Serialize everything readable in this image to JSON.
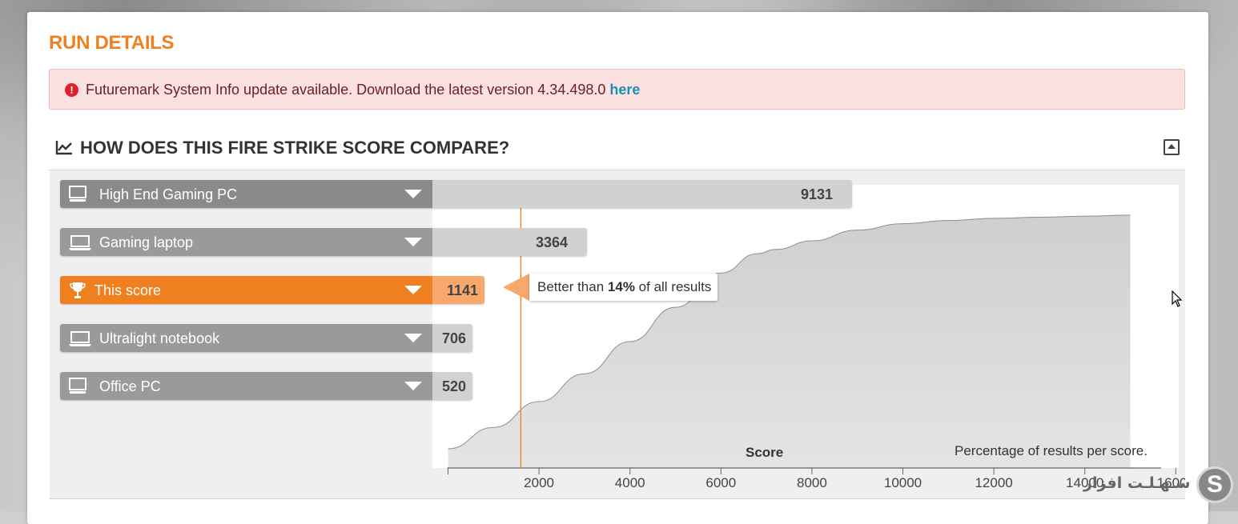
{
  "run_details": {
    "title": "RUN DETAILS"
  },
  "alert": {
    "icon": "error-exclamation-icon",
    "message": "Futuremark System Info update available. Download the latest version 4.34.498.0",
    "link_text": "here",
    "color": "#e0202a"
  },
  "compare": {
    "icon": "line-chart-icon",
    "title": "HOW DOES THIS FIRE STRIKE SCORE COMPARE?",
    "collapse_icon": "collapse-up-icon",
    "max_score": 16000,
    "rows": [
      {
        "label": "High End Gaming PC",
        "score": 9131,
        "icon": "desktop-monitor-icon",
        "highlight": false
      },
      {
        "label": "Gaming laptop",
        "score": 3364,
        "icon": "laptop-icon",
        "highlight": false
      },
      {
        "label": "This score",
        "score": 1141,
        "icon": "trophy-icon",
        "highlight": true
      },
      {
        "label": "Ultralight notebook",
        "score": 706,
        "icon": "laptop-icon",
        "highlight": false
      },
      {
        "label": "Office PC",
        "score": 520,
        "icon": "desktop-monitor-icon",
        "highlight": false
      }
    ],
    "tooltip": {
      "prefix": "Better than",
      "percent": "14%",
      "suffix": "of all results"
    },
    "accent_color": "#f0801f"
  },
  "chart_data": {
    "type": "area",
    "xlabel": "Score",
    "ylabel": "",
    "annotation": "Percentage of results per score.",
    "xlim": [
      0,
      16000
    ],
    "x_ticks": [
      2000,
      4000,
      6000,
      8000,
      10000,
      12000,
      14000,
      16000
    ],
    "marker_score": 1600,
    "x": [
      0,
      1000,
      2000,
      3000,
      4000,
      5000,
      6000,
      6800,
      7200,
      8000,
      9000,
      10000,
      11000,
      12000,
      13000,
      14000,
      15000
    ],
    "y": [
      0,
      10,
      22,
      35,
      50,
      66,
      82,
      91,
      93,
      97,
      102,
      105,
      106.5,
      107.5,
      108,
      108.5,
      109
    ]
  },
  "cursor": {
    "icon": "mouse-pointer-icon"
  },
  "watermark": {
    "text": "سـهـلـت افزار",
    "logo": "S"
  }
}
